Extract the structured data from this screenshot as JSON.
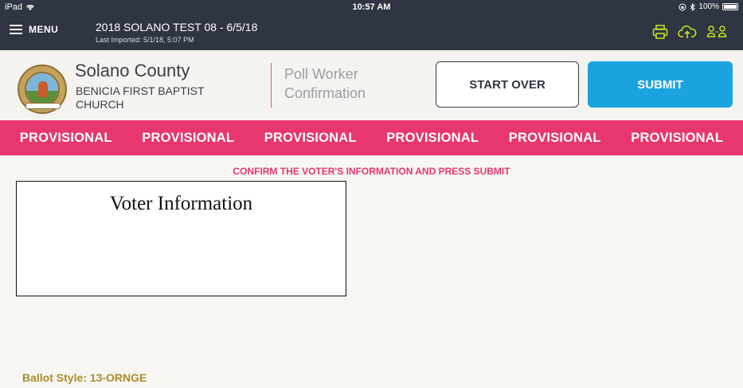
{
  "status_bar": {
    "device": "iPad",
    "time": "10:57 AM",
    "battery": "100%"
  },
  "app_header": {
    "menu_label": "MENU",
    "election_title": "2018 SOLANO TEST 08 - 6/5/18",
    "last_imported": "Last Imported: 5/1/18, 5:07 PM",
    "icons": [
      "printer-icon",
      "cloud-upload-icon",
      "poll-workers-icon"
    ],
    "icon_color": "#c6e81f"
  },
  "header": {
    "county_name": "Solano County",
    "precinct_name": "BENICIA FIRST BAPTIST CHURCH",
    "screen_title": "Poll Worker Confirmation",
    "start_over_label": "START OVER",
    "submit_label": "SUBMIT"
  },
  "provisional_band": {
    "items": [
      "PROVISIONAL",
      "PROVISIONAL",
      "PROVISIONAL",
      "PROVISIONAL",
      "PROVISIONAL",
      "PROVISIONAL"
    ],
    "color": "#e8366e"
  },
  "instruction": "CONFIRM THE VOTER'S INFORMATION AND PRESS SUBMIT",
  "voter_box": {
    "title": "Voter Information"
  },
  "ballot_style": "Ballot Style: 13-ORNGE",
  "colors": {
    "accent_pink": "#e8366e",
    "submit_blue": "#1ba3e0",
    "header_dark": "#2f3542",
    "ballot_gold": "#a98c2a"
  }
}
